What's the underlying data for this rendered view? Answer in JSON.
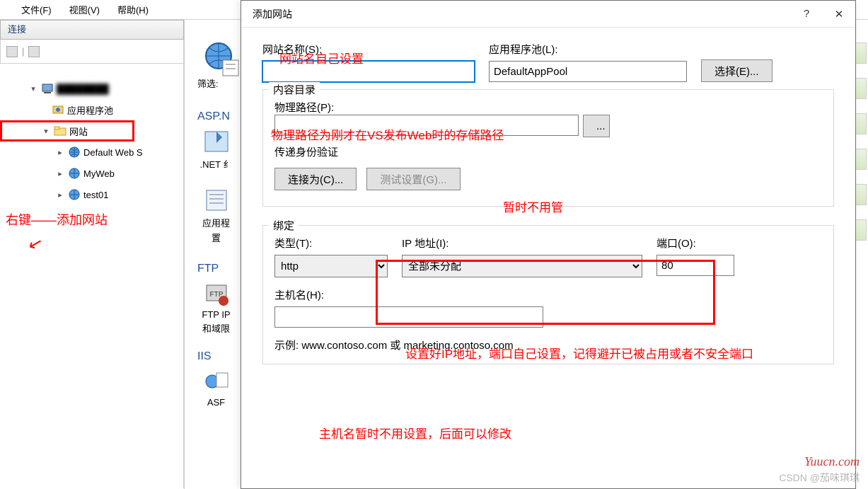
{
  "menu": {
    "file": "文件(F)",
    "view": "视图(V)",
    "help": "帮助(H)"
  },
  "connections": {
    "title": "连接",
    "server_blur": "████████",
    "app_pool": "应用程序池",
    "sites": "网站",
    "site1": "Default Web S",
    "site2": "MyWeb",
    "site3": "test01"
  },
  "annotations": {
    "rightclick": "右键——添加网站",
    "site_name": "网站名自己设置",
    "phys_path": "物理路径为刚才在VS发布Web时的存储路径",
    "ignore": "暂时不用管",
    "ip_port": "设置好IP地址，端口自己设置，记得避开已被占用或者不安全端口",
    "hostname": "主机名暂时不用设置，后面可以修改"
  },
  "mid": {
    "filter": "筛选:",
    "aspn": "ASP.N",
    "net": ".NET 纟",
    "appset1": "应用程",
    "appset2": "置",
    "ftp": "FTP",
    "ftpip1": "FTP IP",
    "ftpip2": "和域限",
    "iis": "IIS",
    "asp": "ASF"
  },
  "dialog": {
    "title": "添加网站",
    "site_name_label": "网站名称(S):",
    "site_name_value": "",
    "app_pool_label": "应用程序池(L):",
    "app_pool_value": "DefaultAppPool",
    "select_btn": "选择(E)...",
    "content_dir": "内容目录",
    "phys_path_label": "物理路径(P):",
    "phys_path_value": "",
    "pass_auth": "传递身份验证",
    "connect_as": "连接为(C)...",
    "test_settings": "测试设置(G)...",
    "binding": "绑定",
    "type_label": "类型(T):",
    "type_value": "http",
    "ip_label": "IP 地址(I):",
    "ip_value": "全部未分配",
    "port_label": "端口(O):",
    "port_value": "80",
    "hostname_label": "主机名(H):",
    "hostname_value": "",
    "example": "示例: www.contoso.com 或 marketing.contoso.com"
  },
  "watermark": "Yuucn.com",
  "csdn": "CSDN @茄味琪琪"
}
